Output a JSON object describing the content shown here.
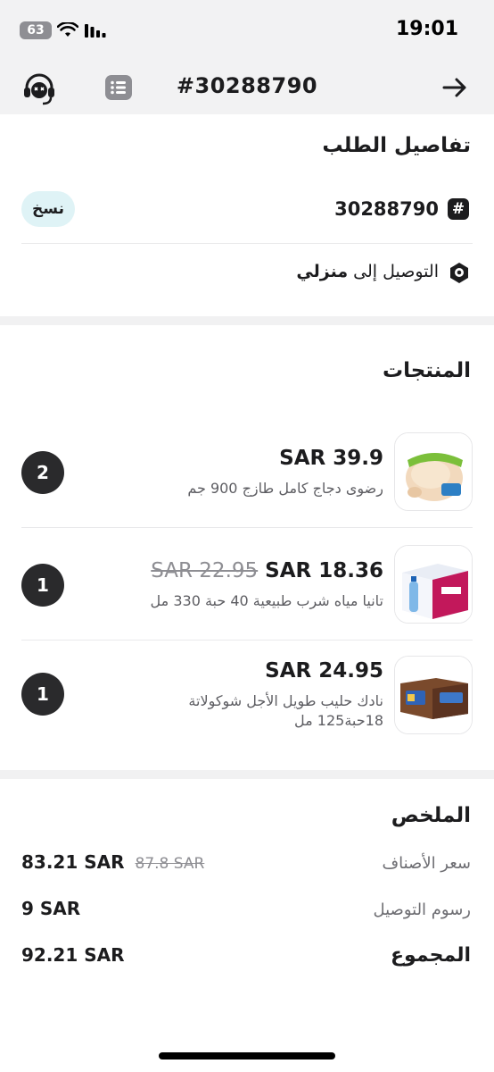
{
  "status_bar": {
    "time": "19:01",
    "battery": "63",
    "icons": [
      "wifi-icon",
      "signal-icon"
    ]
  },
  "header": {
    "title": "#30288790",
    "icons": [
      "support-agent-icon",
      "list-icon",
      "arrow-right-icon"
    ]
  },
  "order_details": {
    "title": "تفاصيل الطلب",
    "copy_label": "نسخ",
    "order_number": "30288790",
    "delivery_prefix": "التوصيل إلى",
    "delivery_place": "منزلي"
  },
  "products": {
    "title": "المنتجات",
    "currency_prefix": "SAR",
    "items": [
      {
        "price": "SAR 39.9",
        "old_price": "",
        "name": "رضوى دجاج كامل طازج 900 جم",
        "quantity": "2",
        "thumb_icon": "chicken-product-image"
      },
      {
        "price": "SAR 18.36",
        "old_price": "SAR 22.95",
        "name": "تانيا مياه شرب طبيعية 40 حبة 330 مل",
        "quantity": "1",
        "thumb_icon": "water-pack-product-image"
      },
      {
        "price": "SAR 24.95",
        "old_price": "",
        "name": "نادك حليب طويل الأجل شوكولاتة 18حبة125 مل",
        "quantity": "1",
        "thumb_icon": "milk-pack-product-image"
      }
    ]
  },
  "summary": {
    "title": "الملخص",
    "items_label": "سعر الأصناف",
    "items_value": "83.21 SAR",
    "items_old_value": "87.8 SAR",
    "delivery_label": "رسوم التوصيل",
    "delivery_value": "9 SAR",
    "total_label": "المجموع",
    "total_value": "92.21 SAR"
  }
}
